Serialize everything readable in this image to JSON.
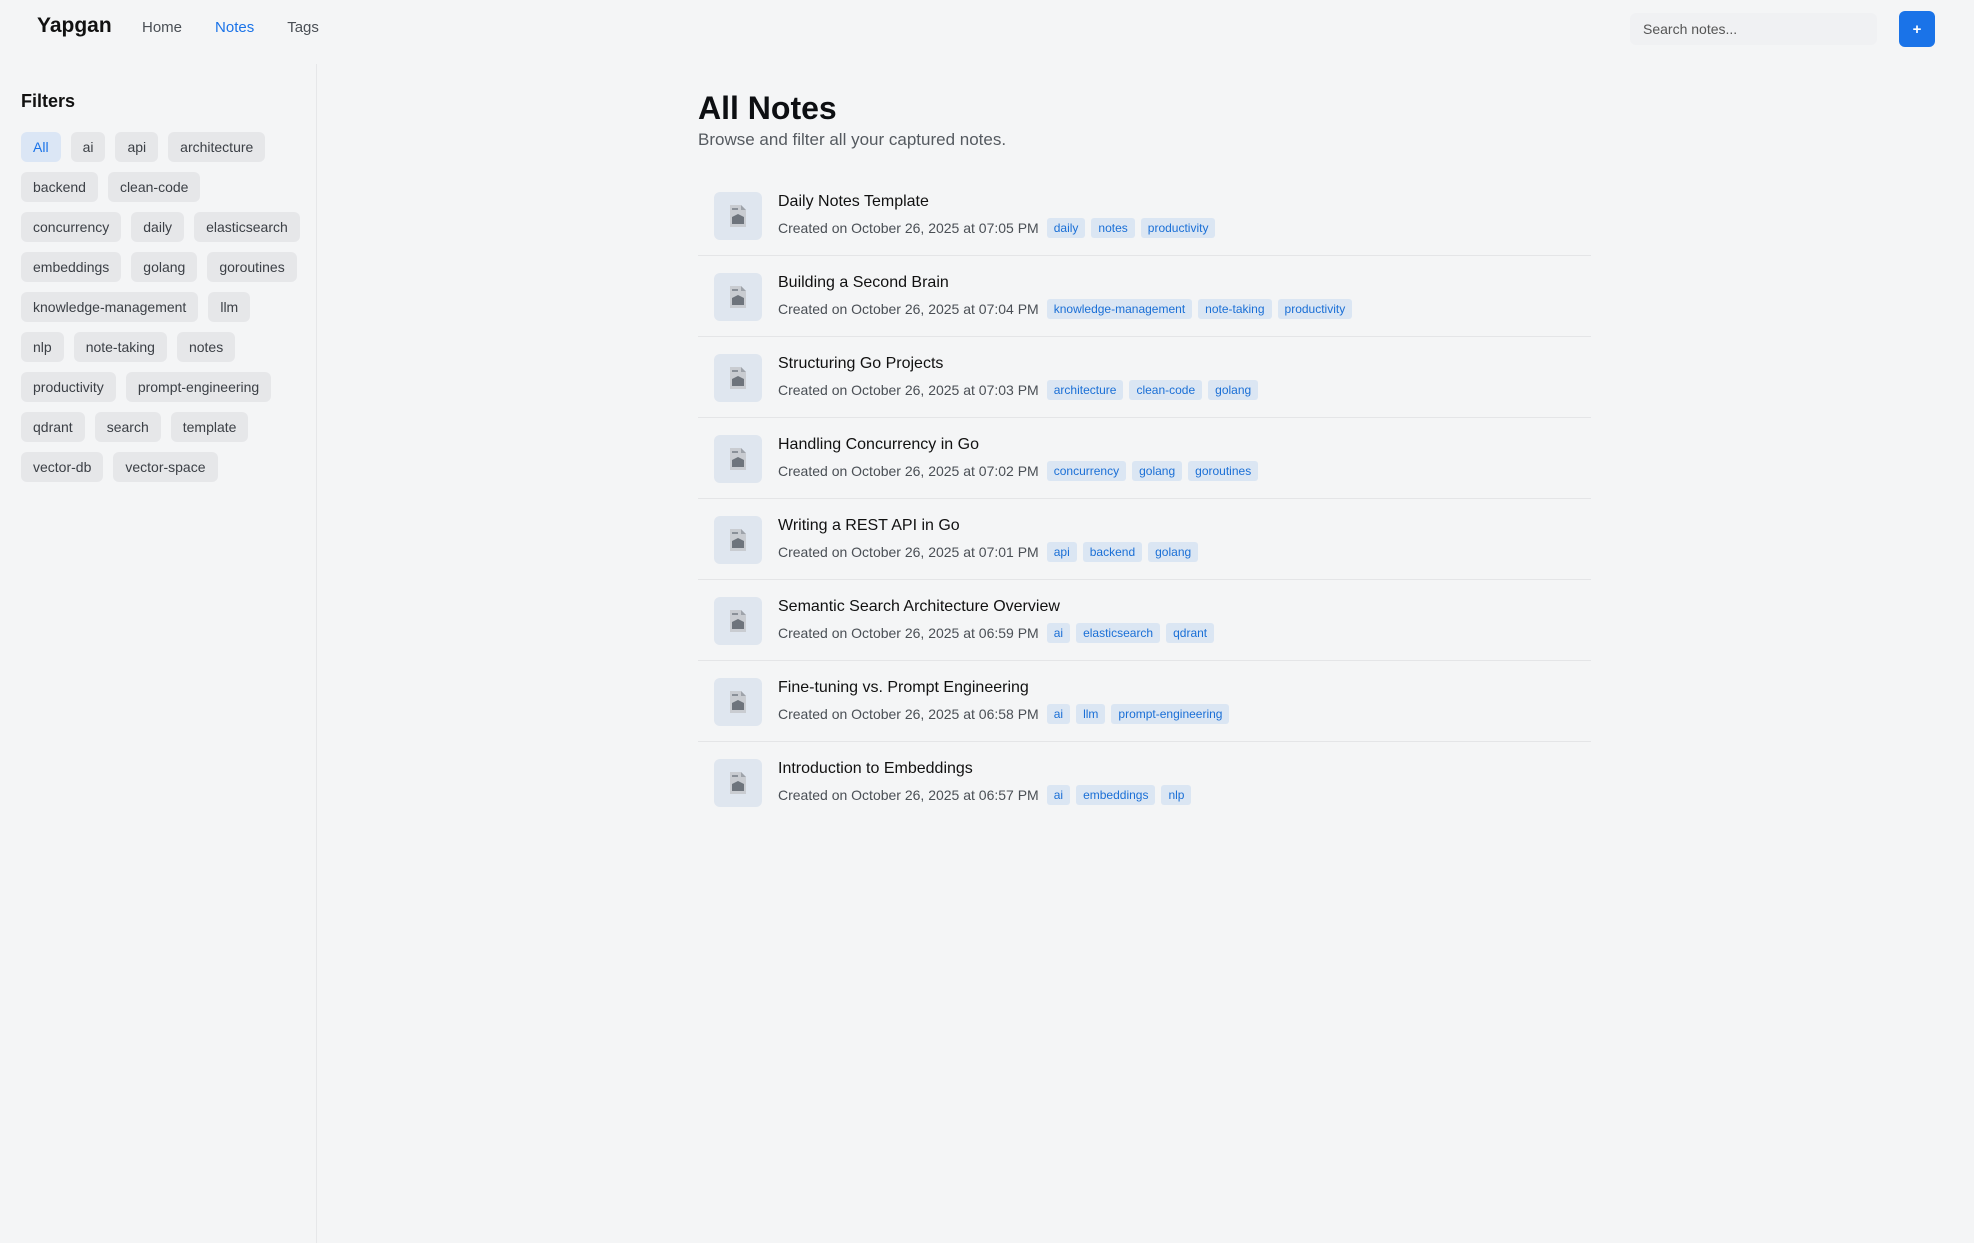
{
  "header": {
    "brand": "Yapgan",
    "nav": [
      {
        "label": "Home",
        "active": false
      },
      {
        "label": "Notes",
        "active": true
      },
      {
        "label": "Tags",
        "active": false
      }
    ],
    "search_placeholder": "Search notes...",
    "add_label": "+",
    "accent_color": "#1a73e8"
  },
  "sidebar": {
    "title": "Filters",
    "chips": [
      {
        "label": "All",
        "active": true
      },
      {
        "label": "ai"
      },
      {
        "label": "api"
      },
      {
        "label": "architecture"
      },
      {
        "label": "backend"
      },
      {
        "label": "clean-code"
      },
      {
        "label": "concurrency"
      },
      {
        "label": "daily"
      },
      {
        "label": "elasticsearch"
      },
      {
        "label": "embeddings"
      },
      {
        "label": "golang"
      },
      {
        "label": "goroutines"
      },
      {
        "label": "knowledge-management"
      },
      {
        "label": "llm"
      },
      {
        "label": "nlp"
      },
      {
        "label": "note-taking"
      },
      {
        "label": "notes"
      },
      {
        "label": "productivity"
      },
      {
        "label": "prompt-engineering"
      },
      {
        "label": "qdrant"
      },
      {
        "label": "search"
      },
      {
        "label": "template"
      },
      {
        "label": "vector-db"
      },
      {
        "label": "vector-space"
      }
    ]
  },
  "main": {
    "title": "All Notes",
    "subtitle": "Browse and filter all your captured notes.",
    "notes": [
      {
        "title": "Daily Notes Template",
        "date": "Created on October 26, 2025 at 07:05 PM",
        "tags": [
          "daily",
          "notes",
          "productivity"
        ]
      },
      {
        "title": "Building a Second Brain",
        "date": "Created on October 26, 2025 at 07:04 PM",
        "tags": [
          "knowledge-management",
          "note-taking",
          "productivity"
        ]
      },
      {
        "title": "Structuring Go Projects",
        "date": "Created on October 26, 2025 at 07:03 PM",
        "tags": [
          "architecture",
          "clean-code",
          "golang"
        ]
      },
      {
        "title": "Handling Concurrency in Go",
        "date": "Created on October 26, 2025 at 07:02 PM",
        "tags": [
          "concurrency",
          "golang",
          "goroutines"
        ]
      },
      {
        "title": "Writing a REST API in Go",
        "date": "Created on October 26, 2025 at 07:01 PM",
        "tags": [
          "api",
          "backend",
          "golang"
        ]
      },
      {
        "title": "Semantic Search Architecture Overview",
        "date": "Created on October 26, 2025 at 06:59 PM",
        "tags": [
          "ai",
          "elasticsearch",
          "qdrant"
        ]
      },
      {
        "title": "Fine-tuning vs. Prompt Engineering",
        "date": "Created on October 26, 2025 at 06:58 PM",
        "tags": [
          "ai",
          "llm",
          "prompt-engineering"
        ]
      },
      {
        "title": "Introduction to Embeddings",
        "date": "Created on October 26, 2025 at 06:57 PM",
        "tags": [
          "ai",
          "embeddings",
          "nlp"
        ]
      }
    ]
  }
}
